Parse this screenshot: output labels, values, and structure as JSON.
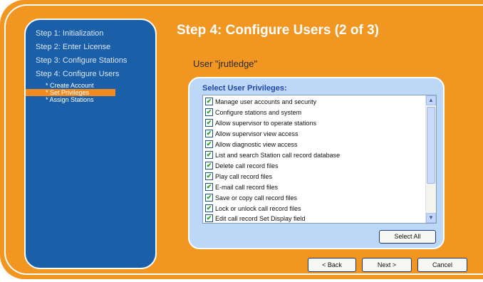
{
  "sidebar": {
    "steps": [
      "Step 1: Initialization",
      "Step 2: Enter License",
      "Step 3: Configure Stations",
      "Step 4: Configure Users"
    ],
    "substeps": [
      "* Create Account",
      "* Set Privileges",
      "* Assign Stations"
    ],
    "active_substep": "* Set Privileges"
  },
  "page": {
    "title": "Step 4: Configure Users (2 of 3)",
    "user_label": "User \"jrutledge\""
  },
  "privileges": {
    "heading": "Select User Privileges:",
    "items": [
      {
        "label": "Manage user accounts and security",
        "checked": true
      },
      {
        "label": "Configure stations and system",
        "checked": true
      },
      {
        "label": "Allow supervisor to operate stations",
        "checked": true
      },
      {
        "label": "Allow supervisor view access",
        "checked": true
      },
      {
        "label": "Allow diagnostic view access",
        "checked": true
      },
      {
        "label": "List and search Station call record database",
        "checked": true
      },
      {
        "label": "Delete call record files",
        "checked": true
      },
      {
        "label": "Play call record files",
        "checked": true
      },
      {
        "label": "E-mail call record files",
        "checked": true
      },
      {
        "label": "Save or copy call record files",
        "checked": true
      },
      {
        "label": "Lock or unlock call record files",
        "checked": true
      },
      {
        "label": "Edit call record Set Display field",
        "checked": true
      }
    ],
    "select_all_label": "Select All"
  },
  "nav": {
    "back_label": "< Back",
    "next_label": "Next >",
    "cancel_label": "Cancel"
  },
  "colors": {
    "frame": "#f29622",
    "sidebar": "#1a5fa8",
    "active_substep": "#f28a1e",
    "panel": "#bdd8f6",
    "heading": "#2046a8"
  }
}
